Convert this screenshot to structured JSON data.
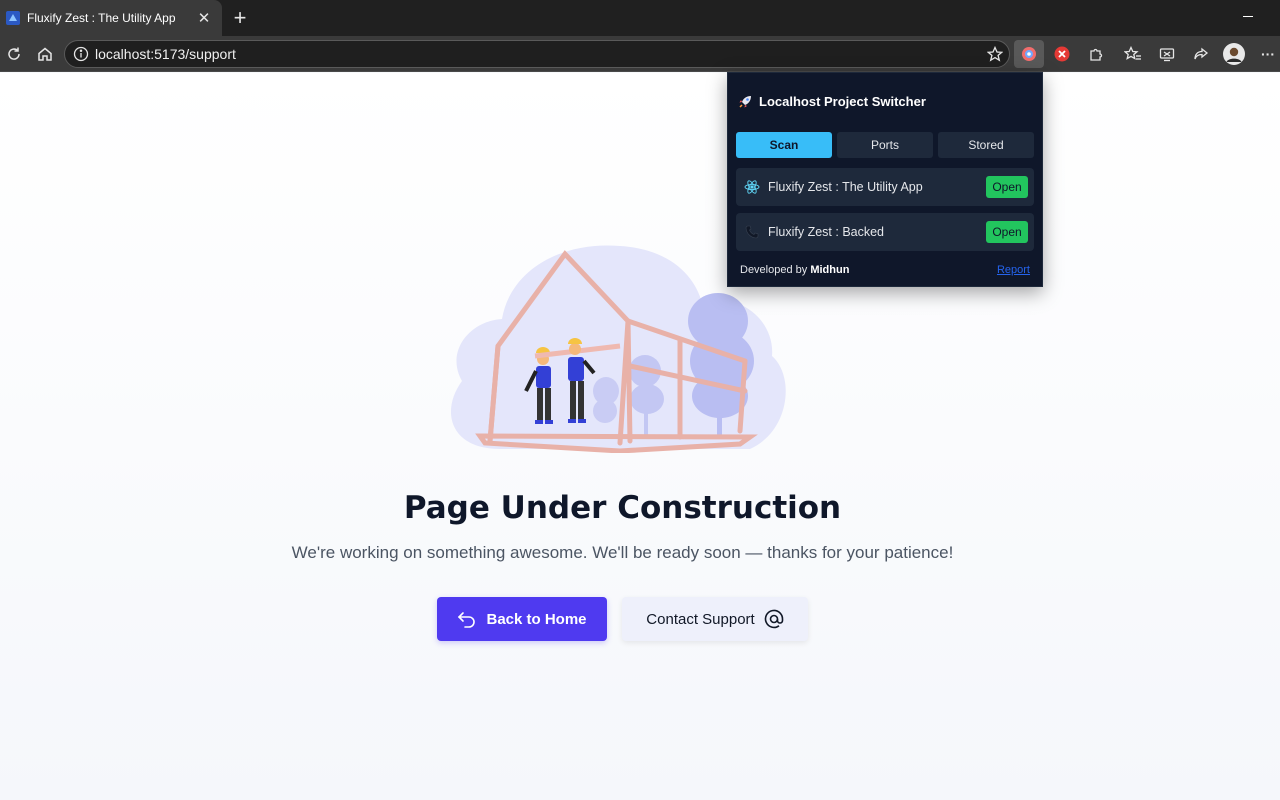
{
  "browser": {
    "tab_title": "Fluxify Zest : The Utility App",
    "tab_close": "✕",
    "new_tab": "+",
    "url": "localhost:5173/support",
    "menu": "···"
  },
  "page": {
    "title": "Page Under Construction",
    "subtitle": "We're working on something awesome. We'll be ready soon — thanks for your patience!",
    "primary_button": "Back to Home",
    "secondary_button": "Contact Support"
  },
  "popup": {
    "title": "Localhost Project Switcher",
    "tabs": [
      "Scan",
      "Ports",
      "Stored"
    ],
    "active_tab": "Scan",
    "projects": [
      {
        "name": "Fluxify Zest : The Utility App",
        "icon": "react-icon",
        "action": "Open"
      },
      {
        "name": "Fluxify Zest : Backed",
        "icon": "phone-icon",
        "action": "Open"
      }
    ],
    "footer_prefix": "Developed by ",
    "footer_author": "Midhun",
    "report": "Report"
  },
  "colors": {
    "primary": "#4f3af0",
    "popup_bg": "#0f172a",
    "popup_accent": "#38bdf8",
    "open_green": "#22c55e"
  }
}
